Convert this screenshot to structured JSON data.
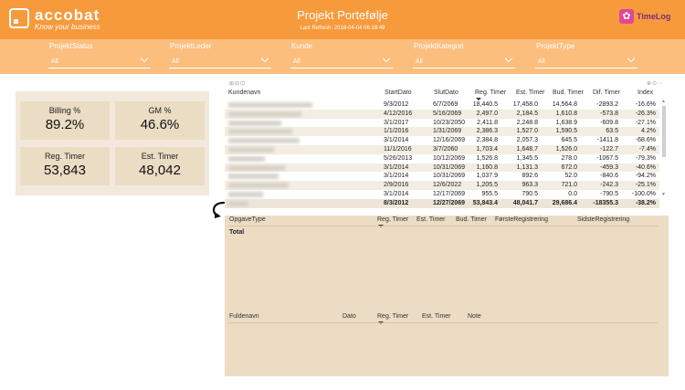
{
  "header": {
    "logo_name": "accobat",
    "logo_tagline": "Know your business",
    "title": "Projekt Portefølje",
    "refresh": "Last Refresh: 2018-04-04 06:18:49",
    "timelog_label": "TimeLog",
    "colors": {
      "header": "#f79a3c",
      "filterbar": "#fbbe7d",
      "panel": "#ecdcc4"
    }
  },
  "filters": [
    {
      "label": "ProjektStatus",
      "value": "All"
    },
    {
      "label": "ProjektLeder",
      "value": "All"
    },
    {
      "label": "Kunde",
      "value": "All"
    },
    {
      "label": "ProjektKategori",
      "value": "All"
    },
    {
      "label": "ProjektType",
      "value": "All"
    }
  ],
  "kpis": [
    {
      "label": "Billing %",
      "value": "89.2%"
    },
    {
      "label": "GM %",
      "value": "46.6%"
    },
    {
      "label": "Reg. Timer",
      "value": "53,843"
    },
    {
      "label": "Est. Timer",
      "value": "48,042"
    }
  ],
  "main_table": {
    "columns": [
      "Kundenavn",
      "StartDato",
      "SlutDato",
      "Reg. Timer",
      "Est. Timer",
      "Bud. Timer",
      "Dif. Timer",
      "Index"
    ],
    "sorted_column": "Reg. Timer",
    "rows": [
      [
        "9/3/2012",
        "6/7/2069",
        "18,440.5",
        "17,458.0",
        "14,564.8",
        "-2893.2",
        "-16.6%"
      ],
      [
        "4/12/2016",
        "5/16/2069",
        "2,497.0",
        "2,184.5",
        "1,610.8",
        "-573.8",
        "-26.3%"
      ],
      [
        "3/1/2017",
        "10/23/2050",
        "2,411.8",
        "2,248.8",
        "1,638.9",
        "-609.8",
        "-27.1%"
      ],
      [
        "1/1/2016",
        "1/31/2069",
        "2,386.3",
        "1,527.0",
        "1,590.5",
        "63.5",
        "4.2%"
      ],
      [
        "3/1/2014",
        "12/16/2069",
        "2,384.8",
        "2,057.3",
        "645.5",
        "-1411.8",
        "-68.6%"
      ],
      [
        "11/1/2016",
        "3/7/2060",
        "1,703.4",
        "1,648.7",
        "1,526.0",
        "-122.7",
        "-7.4%"
      ],
      [
        "5/26/2013",
        "10/12/2069",
        "1,526.8",
        "1,345.5",
        "278.0",
        "-1067.5",
        "-79.3%"
      ],
      [
        "3/1/2014",
        "10/31/2069",
        "1,160.8",
        "1,131.3",
        "672.0",
        "-459.3",
        "-40.6%"
      ],
      [
        "3/1/2014",
        "10/31/2069",
        "1,037.9",
        "892.6",
        "52.0",
        "-840.6",
        "-94.2%"
      ],
      [
        "2/9/2016",
        "12/6/2022",
        "1,205.5",
        "963.3",
        "721.0",
        "-242.3",
        "-25.1%"
      ],
      [
        "3/1/2014",
        "12/17/2069",
        "955.5",
        "790.5",
        "0.0",
        "-790.5",
        "-100.0%"
      ]
    ],
    "total": [
      "8/3/2012",
      "12/27/2069",
      "53,843.4",
      "48,041.7",
      "29,686.4",
      "-18355.3",
      "-38.2%"
    ]
  },
  "opgave_table": {
    "columns": [
      "OpgaveType",
      "Reg. Timer",
      "Est. Timer",
      "Bud. Timer",
      "FørsteRegistrering",
      "SidsteRegistrering"
    ],
    "total_label": "Total"
  },
  "fulde_table": {
    "columns": [
      "Fuldenavn",
      "Dato",
      "Reg. Timer",
      "Est. Timer",
      "Note"
    ]
  }
}
